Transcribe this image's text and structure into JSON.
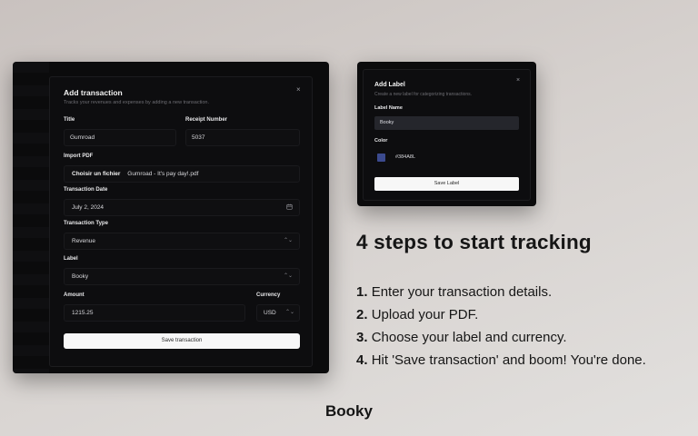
{
  "transaction_dialog": {
    "title": "Add transaction",
    "subtitle": "Tracks your revenues and expenses by adding a new transaction.",
    "close_glyph": "×",
    "title_label": "Title",
    "title_value": "Gumroad",
    "receipt_label": "Receipt Number",
    "receipt_value": "5037",
    "import_label": "Import PDF",
    "file_button": "Choisir un fichier",
    "file_name": "Gumroad - It's pay day!.pdf",
    "date_label": "Transaction Date",
    "date_value": "July 2, 2024",
    "type_label": "Transaction Type",
    "type_value": "Revenue",
    "label_label": "Label",
    "label_value": "Booky",
    "amount_label": "Amount",
    "amount_value": "1215.25",
    "currency_label": "Currency",
    "currency_value": "USD",
    "save_button": "Save transaction"
  },
  "label_dialog": {
    "title": "Add Label",
    "subtitle": "Create a new label for categorizing transactions.",
    "close_glyph": "×",
    "name_label": "Label Name",
    "name_value": "Booky",
    "color_label": "Color",
    "color_value": "#384A8L",
    "swatch_color": "#3b4a8e",
    "save_button": "Save Label"
  },
  "marketing": {
    "headline": "4 steps to start tracking",
    "steps": [
      {
        "num": "1.",
        "text": "Enter your transaction details."
      },
      {
        "num": "2.",
        "text": "Upload your PDF."
      },
      {
        "num": "3.",
        "text": "Choose your label and currency."
      },
      {
        "num": "4.",
        "text": "Hit 'Save transaction' and boom! You're done."
      }
    ],
    "brand": "Booky"
  },
  "icons": {
    "calendar": "calendar-icon",
    "select": "chevron-updown-icon"
  }
}
